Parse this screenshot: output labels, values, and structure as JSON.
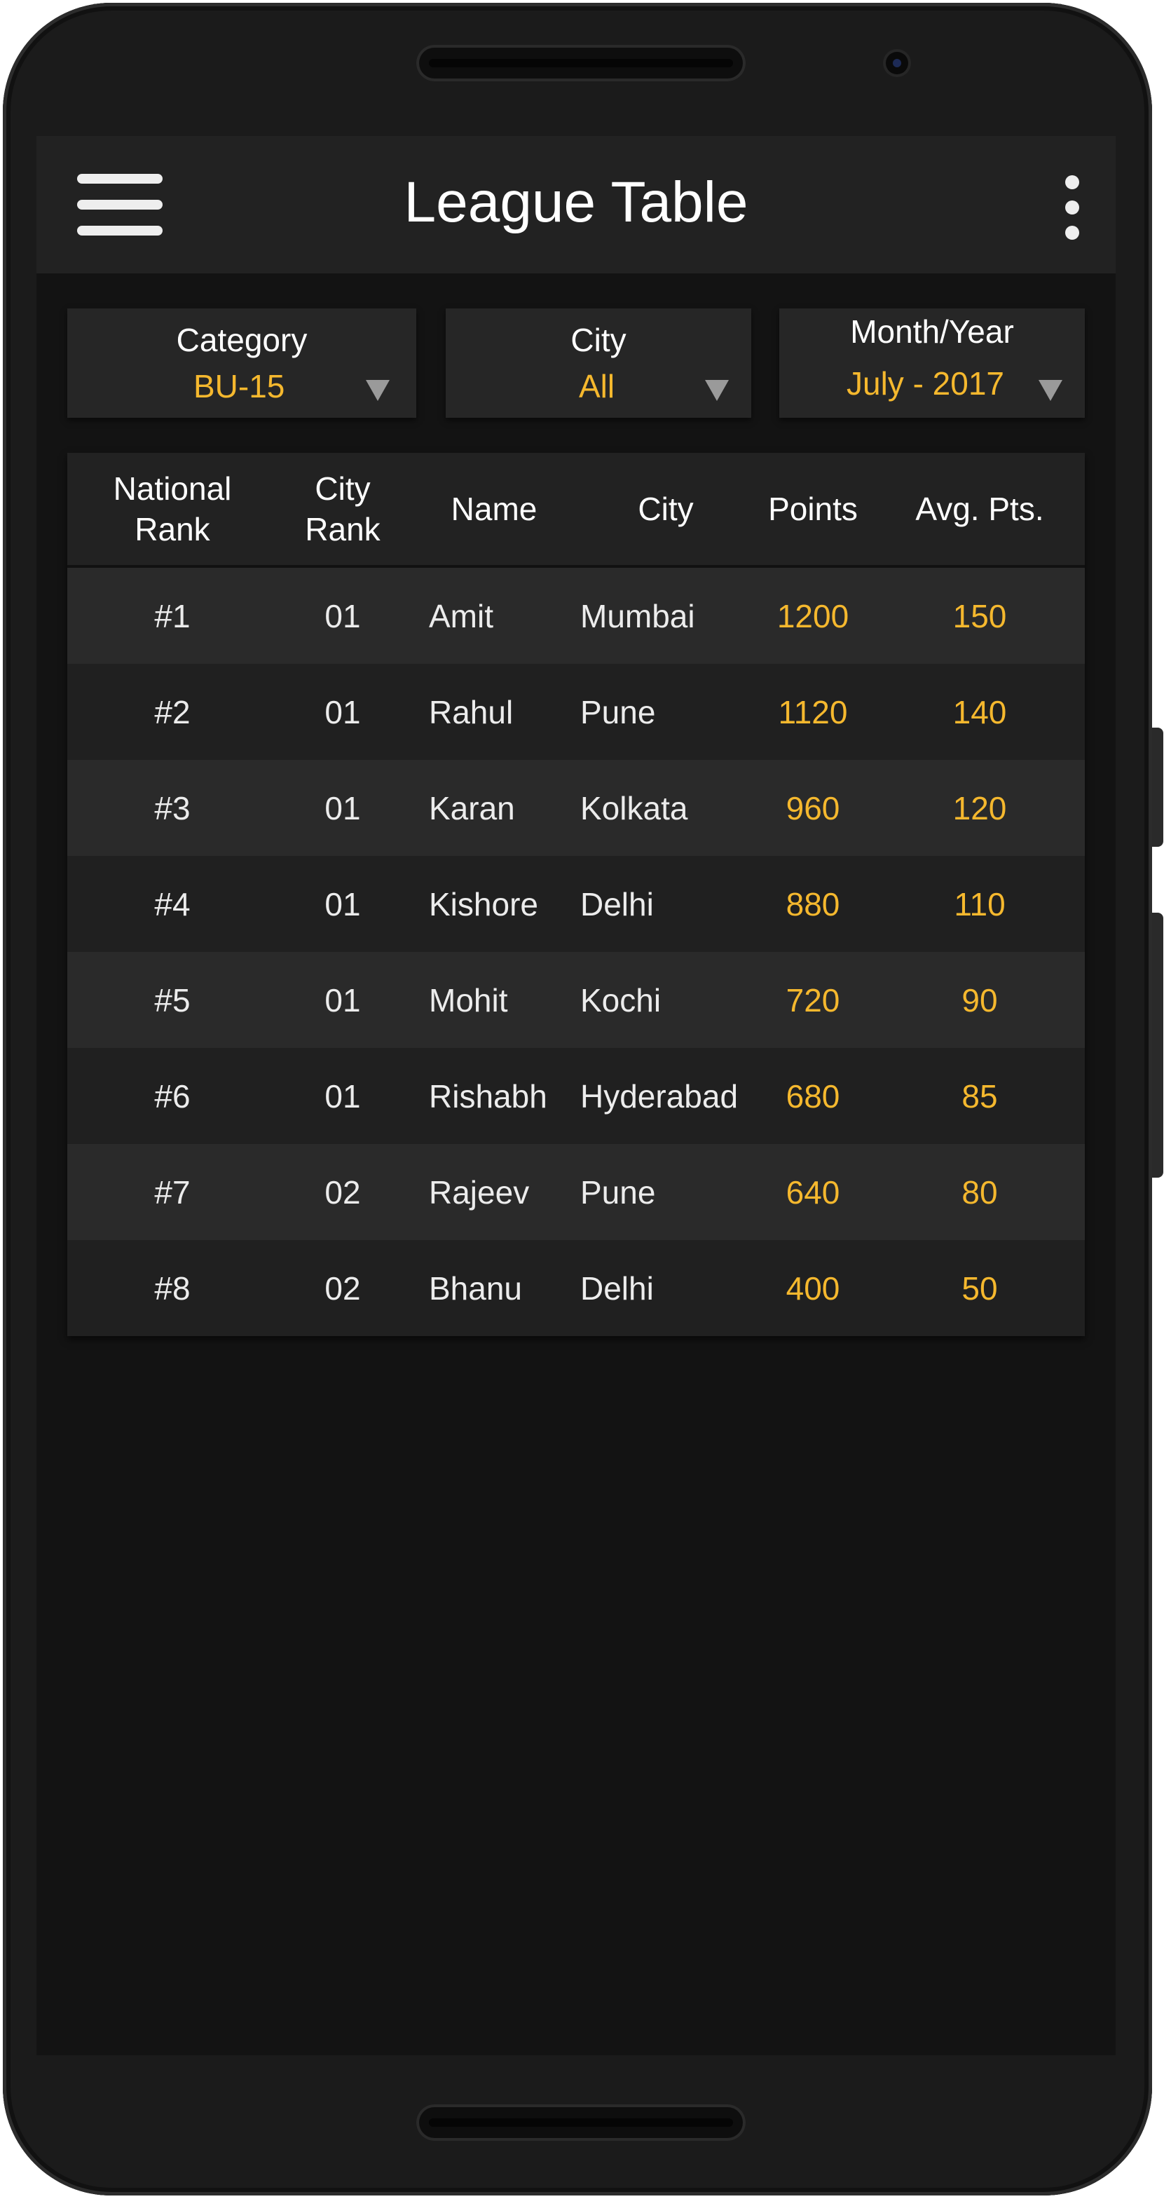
{
  "app_bar": {
    "title": "League Table",
    "menu_icon": "hamburger-menu-icon",
    "overflow_icon": "more-vert-icon"
  },
  "filters": {
    "category": {
      "label": "Category",
      "value": "BU-15"
    },
    "city": {
      "label": "City",
      "value": "All"
    },
    "month_year": {
      "label": "Month/Year",
      "value": "July - 2017"
    },
    "dropdown_icon": "triangle-down-icon"
  },
  "table": {
    "headers": {
      "national_rank_line1": "National",
      "national_rank_line2": "Rank",
      "city_rank_line1": "City",
      "city_rank_line2": "Rank",
      "name": "Name",
      "city": "City",
      "points": "Points",
      "avg_points": "Avg. Pts."
    },
    "rows": [
      {
        "national_rank": "#1",
        "city_rank": "01",
        "name": "Amit",
        "city": "Mumbai",
        "points": "1200",
        "avg_points": "150"
      },
      {
        "national_rank": "#2",
        "city_rank": "01",
        "name": "Rahul",
        "city": "Pune",
        "points": "1120",
        "avg_points": "140"
      },
      {
        "national_rank": "#3",
        "city_rank": "01",
        "name": "Karan",
        "city": "Kolkata",
        "points": "960",
        "avg_points": "120"
      },
      {
        "national_rank": "#4",
        "city_rank": "01",
        "name": "Kishore",
        "city": "Delhi",
        "points": "880",
        "avg_points": "110"
      },
      {
        "national_rank": "#5",
        "city_rank": "01",
        "name": "Mohit",
        "city": "Kochi",
        "points": "720",
        "avg_points": "90"
      },
      {
        "national_rank": "#6",
        "city_rank": "01",
        "name": "Rishabh",
        "city": "Hyderabad",
        "points": "680",
        "avg_points": "85"
      },
      {
        "national_rank": "#7",
        "city_rank": "02",
        "name": "Rajeev",
        "city": "Pune",
        "points": "640",
        "avg_points": "80"
      },
      {
        "national_rank": "#8",
        "city_rank": "02",
        "name": "Bhanu",
        "city": "Delhi",
        "points": "400",
        "avg_points": "50"
      }
    ]
  },
  "colors": {
    "accent": "#f5b82e",
    "app_bar": "#222222",
    "screen_background": "#131313",
    "row_light": "#2a2a2a",
    "row_dark": "#202020"
  }
}
